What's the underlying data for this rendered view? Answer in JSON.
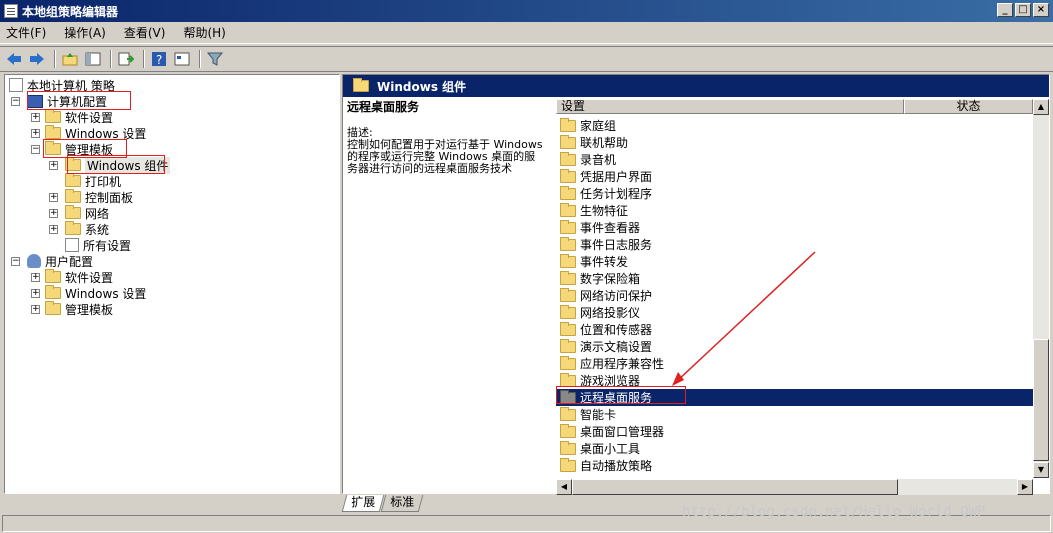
{
  "window": {
    "title": "本地组策略编辑器",
    "min": "_",
    "max": "□",
    "close": "×"
  },
  "menu": {
    "file": "文件(F)",
    "action": "操作(A)",
    "view": "查看(V)",
    "help": "帮助(H)"
  },
  "tree": {
    "root": "本地计算机 策略",
    "computer_config": "计算机配置",
    "software_settings": "软件设置",
    "windows_settings": "Windows 设置",
    "admin_templates": "管理模板",
    "windows_components": "Windows 组件",
    "printers": "打印机",
    "control_panel": "控制面板",
    "network": "网络",
    "system": "系统",
    "all_settings": "所有设置",
    "user_config": "用户配置",
    "user_software_settings": "软件设置",
    "user_windows_settings": "Windows 设置",
    "user_admin_templates": "管理模板"
  },
  "right": {
    "header": "Windows 组件",
    "desc_title": "远程桌面服务",
    "desc_label": "描述:",
    "desc_text": "控制如何配置用于对运行基于 Windows 的程序或运行完整 Windows 桌面的服务器进行访问的远程桌面服务技术",
    "col_setting": "设置",
    "col_state": "状态",
    "items": [
      "家庭组",
      "联机帮助",
      "录音机",
      "凭据用户界面",
      "任务计划程序",
      "生物特征",
      "事件查看器",
      "事件日志服务",
      "事件转发",
      "数字保险箱",
      "网络访问保护",
      "网络投影仪",
      "位置和传感器",
      "演示文稿设置",
      "应用程序兼容性",
      "游戏浏览器",
      "远程桌面服务",
      "智能卡",
      "桌面窗口管理器",
      "桌面小工具",
      "自动播放策略"
    ],
    "selected_index": 16
  },
  "tabs": {
    "extended": "扩展",
    "standard": "标准"
  },
  "watermark": "http://blog.csdn.net/Hello_World_QWP"
}
